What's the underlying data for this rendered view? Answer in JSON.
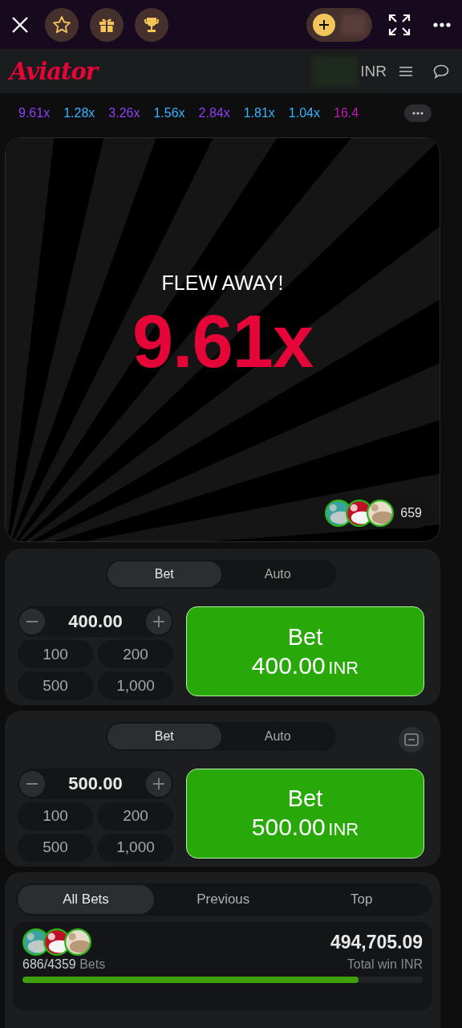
{
  "header": {
    "logo": "Aviator",
    "currency": "INR"
  },
  "history": [
    {
      "value": "9.61x",
      "color": "#913ef8"
    },
    {
      "value": "1.28x",
      "color": "#34b4ff"
    },
    {
      "value": "3.26x",
      "color": "#913ef8"
    },
    {
      "value": "1.56x",
      "color": "#34b4ff"
    },
    {
      "value": "2.84x",
      "color": "#913ef8"
    },
    {
      "value": "1.81x",
      "color": "#34b4ff"
    },
    {
      "value": "1.04x",
      "color": "#34b4ff"
    },
    {
      "value": "16.4",
      "color": "#c017b4"
    }
  ],
  "game": {
    "status": "FLEW AWAY!",
    "multiplier": "9.61x",
    "players": "659"
  },
  "bet_panels": [
    {
      "tabs": [
        {
          "label": "Bet",
          "selected": true
        },
        {
          "label": "Auto",
          "selected": false
        }
      ],
      "amount": "400.00",
      "quick_amounts": [
        "100",
        "200",
        "500",
        "1,000"
      ],
      "button": {
        "label": "Bet",
        "amount": "400.00",
        "currency": "INR"
      },
      "removable": false
    },
    {
      "tabs": [
        {
          "label": "Bet",
          "selected": true
        },
        {
          "label": "Auto",
          "selected": false
        }
      ],
      "amount": "500.00",
      "quick_amounts": [
        "100",
        "200",
        "500",
        "1,000"
      ],
      "button": {
        "label": "Bet",
        "amount": "500.00",
        "currency": "INR"
      },
      "removable": true
    }
  ],
  "bets": {
    "tabs": [
      {
        "label": "All Bets",
        "selected": true
      },
      {
        "label": "Previous",
        "selected": false
      },
      {
        "label": "Top",
        "selected": false
      }
    ],
    "count": "686/4359",
    "count_label": "Bets",
    "total": "494,705.09",
    "total_label": "Total win INR",
    "level": 0.84
  }
}
